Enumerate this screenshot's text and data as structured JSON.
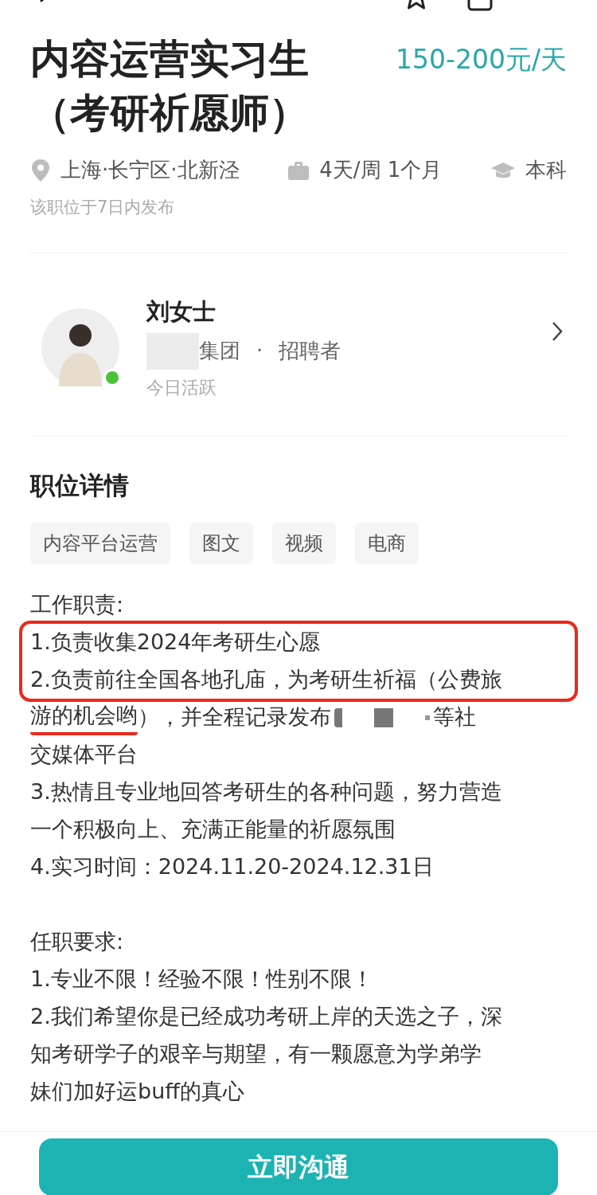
{
  "job": {
    "title_lines": [
      "内容运营实习生",
      "（考研祈愿师）"
    ],
    "salary": "150-200元/天",
    "meta": [
      {
        "kind": "location",
        "text": "上海·长宁区·北新泾"
      },
      {
        "kind": "schedule",
        "text": "4天/周 1个月"
      },
      {
        "kind": "education",
        "text": "本科"
      }
    ],
    "posted": "该职位于7日内发布"
  },
  "recruiter": {
    "name": "刘女士",
    "company": "集团",
    "company_redacted": true,
    "role": "招聘者",
    "separator": "·",
    "activity": "今日活跃",
    "online": true
  },
  "details": {
    "heading": "职位详情",
    "tags": [
      "内容平台运营",
      "图文",
      "视频",
      "电商"
    ],
    "sections": [
      {
        "heading": "工作职责:",
        "groups": [
          {
            "boxed": true,
            "lines": [
              [
                {
                  "kind": "plain",
                  "text": "1.负责收集2024年考研生心愿"
                }
              ],
              [
                {
                  "kind": "plain",
                  "text": "2.负责前往全国各地孔庙，为考研生祈福（公费旅"
                }
              ]
            ]
          },
          {
            "boxed": false,
            "lines": [
              [
                {
                  "kind": "underlined",
                  "text": "游的机会哟"
                },
                {
                  "kind": "plain",
                  "text": "），并全程记录发布"
                },
                {
                  "kind": "redacted"
                },
                {
                  "kind": "plain",
                  "text": "等社"
                }
              ],
              [
                {
                  "kind": "plain",
                  "text": "交媒体平台"
                }
              ],
              [
                {
                  "kind": "plain",
                  "text": "3.热情且专业地回答考研生的各种问题，努力营造"
                }
              ],
              [
                {
                  "kind": "plain",
                  "text": "一个积极向上、充满正能量的祈愿氛围"
                }
              ],
              [
                {
                  "kind": "plain",
                  "text": "4.实习时间：2024.11.20-2024.12.31日"
                }
              ]
            ]
          }
        ]
      },
      {
        "heading": "任职要求:",
        "groups": [
          {
            "boxed": false,
            "lines": [
              [
                {
                  "kind": "plain",
                  "text": "1.专业不限！经验不限！性别不限！"
                }
              ],
              [
                {
                  "kind": "plain",
                  "text": "2.我们希望你是已经成功考研上岸的天选之子，深"
                }
              ],
              [
                {
                  "kind": "plain",
                  "text": "知考研学子的艰辛与期望，有一颗愿意为学弟学"
                }
              ],
              [
                {
                  "kind": "plain",
                  "text": "妹们加好运buff的真心"
                }
              ]
            ]
          }
        ]
      }
    ]
  },
  "action_button": "立即沟通"
}
